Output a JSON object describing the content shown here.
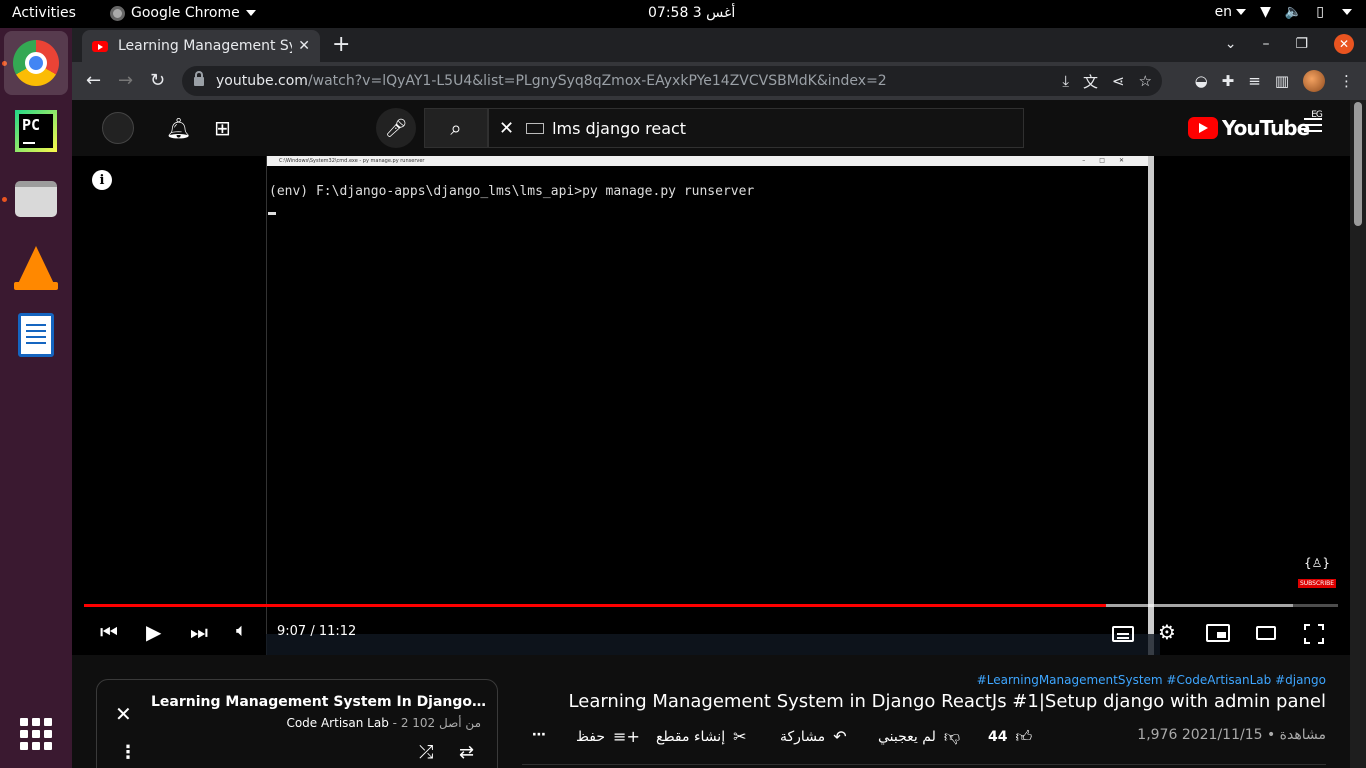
{
  "system": {
    "activities": "Activities",
    "app_name": "Google Chrome",
    "clock": "07:58  3 أغس",
    "language": "en"
  },
  "dock": {
    "items": [
      "chrome",
      "pycharm",
      "files",
      "vlc",
      "libreoffice-writer"
    ]
  },
  "browser": {
    "tab_title": "Learning Management System In Django ReactJs",
    "url_host": "youtube.com",
    "url_path": "/watch?v=lQyAY1-L5U4&list=PLgnySyq8qZmox-EAyxkPYe14ZVCVSBMdK&index=2"
  },
  "youtube": {
    "search_query": "lms django react",
    "logo_text": "YouTube",
    "region": "EG",
    "player": {
      "cmd_title": "C:\\Windows\\System32\\cmd.exe - py  manage.py runserver",
      "cmd_line": "(env) F:\\django-apps\\django_lms\\lms_api>py manage.py runserver",
      "time_display": "9:07 / 11:12",
      "played_fraction": 0.815,
      "buffered_fraction": 0.964,
      "subscribe_watermark": "SUBSCRIBE",
      "watermark_glyph": "{♙}"
    },
    "playlist": {
      "title": "Learning Management System In Django ReactJs (...",
      "channel": "Code Artisan Lab",
      "position": "2 من أصل 102"
    },
    "video": {
      "hashtags": "#LearningManagementSystem #CodeArtisanLab #django",
      "title": "Learning Management System in Django ReactJs #1|Setup django with admin panel",
      "views_date": "1,976 مشاهدة • 2021/11/15",
      "likes": "44",
      "dislike_label": "لم يعجبني",
      "share_label": "مشاركة",
      "clip_label": "إنشاء مقطع",
      "save_label": "حفظ"
    }
  }
}
